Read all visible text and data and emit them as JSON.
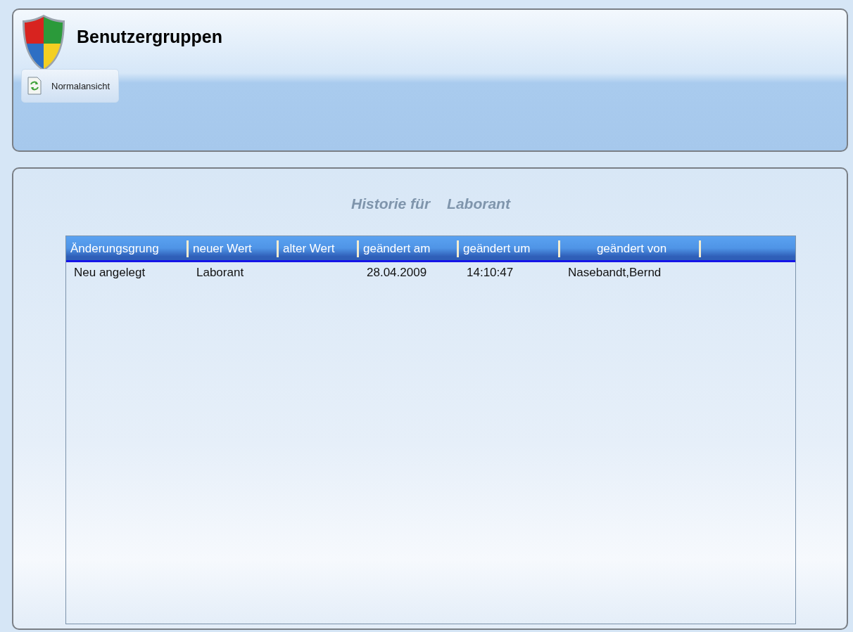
{
  "header": {
    "title": "Benutzergruppen",
    "buttons": [
      {
        "label": "Normalansicht"
      }
    ]
  },
  "history": {
    "title_prefix": "Historie für",
    "title_subject": "Laborant",
    "table": {
      "columns": [
        "Änderungsgrung",
        "neuer Wert",
        "alter Wert",
        "geändert am",
        "geändert um",
        "geändert von"
      ],
      "rows": [
        [
          "Neu angelegt",
          "Laborant",
          "",
          "28.04.2009",
          "14:10:47",
          "Nasebandt,Bernd"
        ]
      ]
    }
  }
}
